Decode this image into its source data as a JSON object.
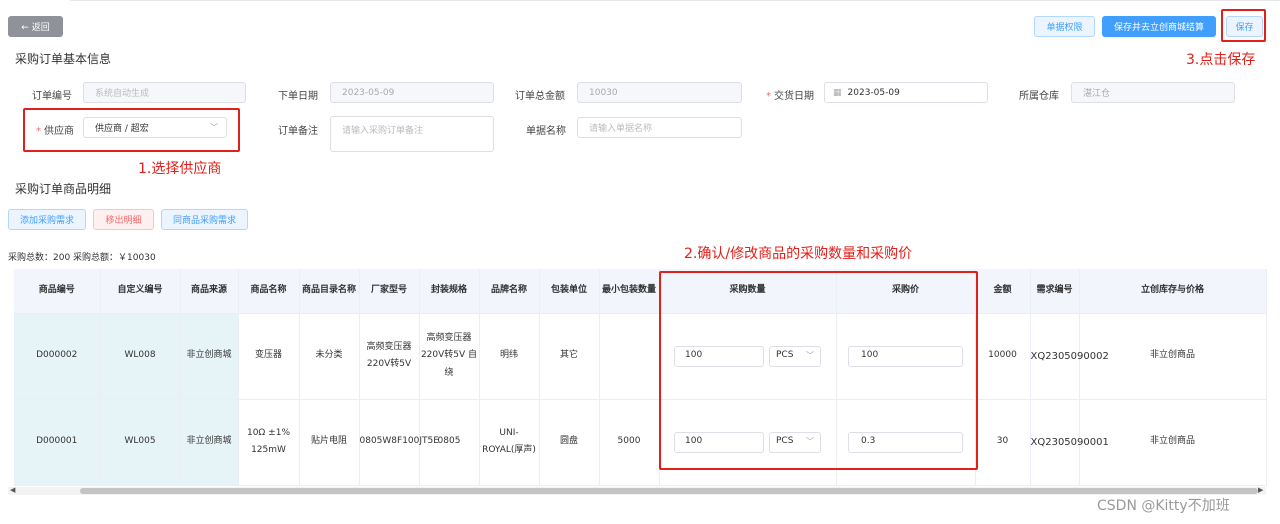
{
  "header": {
    "back_icon": "arrow-left-icon",
    "back_label": "← 返回",
    "permissions_label": "单据权限",
    "save_and_settle_label": "保存并去立创商城结算",
    "save_label": "保存"
  },
  "basic_info": {
    "title": "采购订单基本信息",
    "order_no": {
      "label": "订单编号",
      "placeholder": "系统自动生成"
    },
    "order_date": {
      "label": "下单日期",
      "value": "2023-05-09"
    },
    "total_amount": {
      "label": "订单总金额",
      "value": "10030"
    },
    "delivery_date": {
      "label": "交货日期",
      "value": "2023-05-09",
      "icon": "calendar-icon"
    },
    "warehouse": {
      "label": "所属仓库",
      "value": "湛江仓"
    },
    "supplier": {
      "label": "供应商",
      "value": "供应商 / 超宏"
    },
    "remark": {
      "label": "订单备注",
      "placeholder": "请输入采购订单备注"
    },
    "doc_name": {
      "label": "单据名称",
      "placeholder": "请输入单据名称"
    }
  },
  "annotations": {
    "a1": "1.选择供应商",
    "a2": "2.确认/修改商品的采购数量和采购价",
    "a3": "3.点击保存"
  },
  "items_section": {
    "title": "采购订单商品明细",
    "add_btn": "添加采购需求",
    "remove_btn": "移出明细",
    "same_btn": "同商品采购需求",
    "summary": "采购总数：200 采购总额：￥10030"
  },
  "table": {
    "headers": [
      "商品编号",
      "自定义编号",
      "商品来源",
      "商品名称",
      "商品目录名称",
      "厂家型号",
      "封装规格",
      "品牌名称",
      "包装单位",
      "最小包装数量",
      "采购数量",
      "采购价",
      "金额",
      "需求编号",
      "立创库存与价格"
    ],
    "rows": [
      {
        "code": "D000002",
        "custom": "WL008",
        "source": "非立创商城",
        "name": "变压器",
        "catalog": "未分类",
        "model": "高频变压器220V转5V",
        "spec": "高频变压器220V转5V 自绕",
        "brand": "明纬",
        "unit": "其它",
        "min_pack": "",
        "qty": "100",
        "qty_unit": "PCS",
        "price": "100",
        "amount": "10000",
        "req_no": "XQ2305090002",
        "stock": "非立创商品"
      },
      {
        "code": "D000001",
        "custom": "WL005",
        "source": "非立创商城",
        "name": "10Ω ±1% 125mW",
        "catalog": "贴片电阻",
        "model": "0805W8F100JT5E",
        "spec": "0805",
        "brand": "UNI-ROYAL(厚声)",
        "unit": "圆盘",
        "min_pack": "5000",
        "qty": "100",
        "qty_unit": "PCS",
        "price": "0.3",
        "amount": "30",
        "req_no": "XQ2305090001",
        "stock": "非立创商品"
      }
    ]
  },
  "watermark": "CSDN @Kitty不加班"
}
